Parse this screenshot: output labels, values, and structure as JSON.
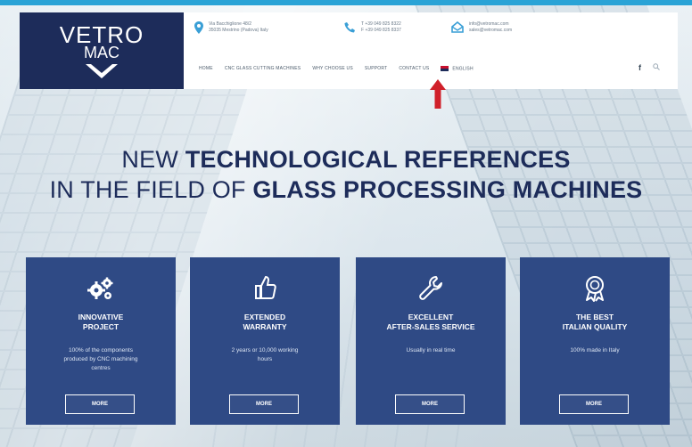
{
  "brand": {
    "line1": "VETRO",
    "line2": "MAC"
  },
  "contacts": [
    {
      "icon": "map-pin-icon",
      "line1": "Via Bacchiglione 48/2",
      "line2": "35035 Mestrino (Padova) Italy"
    },
    {
      "icon": "phone-icon",
      "line1": "T +39 049 825 8322",
      "line2": "F +39 049 825 8337"
    },
    {
      "icon": "mail-icon",
      "line1": "info@vetromac.com",
      "line2": "sales@vetromac.com"
    }
  ],
  "nav": {
    "items": [
      "HOME",
      "CNC GLASS CUTTING MACHINES",
      "WHY CHOOSE US",
      "SUPPORT",
      "CONTACT US"
    ],
    "language": "ENGLISH",
    "social_icon": "facebook-icon",
    "search_icon": "search-icon"
  },
  "headline": {
    "line1_light": "NEW ",
    "line1_bold": "TECHNOLOGICAL REFERENCES",
    "line2_light": "IN THE FIELD OF ",
    "line2_bold": "GLASS PROCESSING MACHINES"
  },
  "cards": [
    {
      "icon": "gears-icon",
      "title": "INNOVATIVE\nPROJECT",
      "desc": "100% of the components\nproduced by CNC machining\ncentres",
      "button": "MORE"
    },
    {
      "icon": "thumbs-up-icon",
      "title": "EXTENDED\nWARRANTY",
      "desc": "2 years or 10,000 working\nhours",
      "button": "MORE"
    },
    {
      "icon": "wrench-icon",
      "title": "EXCELLENT\nAFTER-SALES SERVICE",
      "desc": "Usually in real time",
      "button": "MORE"
    },
    {
      "icon": "award-ribbon-icon",
      "title": "THE BEST\nITALIAN QUALITY",
      "desc": "100% made in Italy",
      "button": "MORE"
    }
  ],
  "colors": {
    "brand_navy": "#1d2c5a",
    "card_blue": "#2f4a85",
    "accent_blue": "#2aa3d6",
    "annotation_red": "#d0202a"
  }
}
